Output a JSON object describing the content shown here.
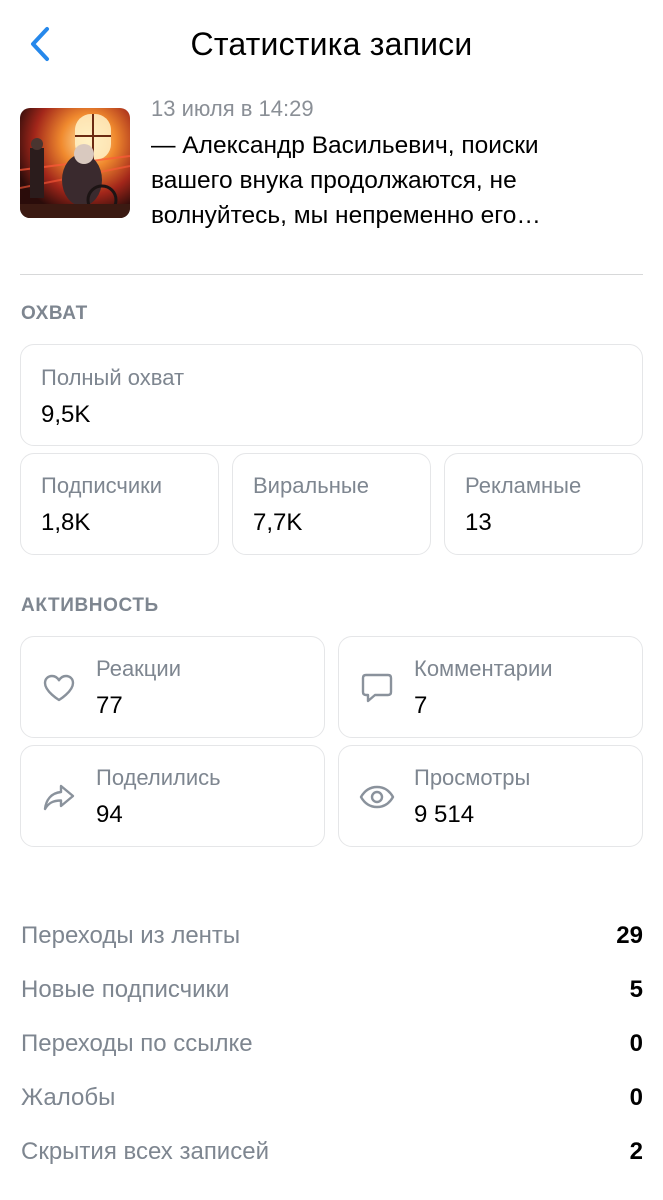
{
  "header": {
    "title": "Статистика записи"
  },
  "post": {
    "date": "13 июля в 14:29",
    "text": "— Александр Васильевич, поиски вашего внука продолжаются, не волнуйтесь, мы непременно его…"
  },
  "reach": {
    "section_title": "ОХВАТ",
    "total": {
      "label": "Полный охват",
      "value": "9,5K"
    },
    "subscribers": {
      "label": "Подписчики",
      "value": "1,8K"
    },
    "viral": {
      "label": "Виральные",
      "value": "7,7K"
    },
    "ads": {
      "label": "Рекламные",
      "value": "13"
    }
  },
  "activity": {
    "section_title": "АКТИВНОСТЬ",
    "reactions": {
      "label": "Реакции",
      "value": "77",
      "icon": "heart-icon"
    },
    "comments": {
      "label": "Комментарии",
      "value": "7",
      "icon": "comment-icon"
    },
    "shares": {
      "label": "Поделились",
      "value": "94",
      "icon": "share-icon"
    },
    "views": {
      "label": "Просмотры",
      "value": "9 514",
      "icon": "eye-icon"
    }
  },
  "stats": [
    {
      "label": "Переходы из ленты",
      "value": "29"
    },
    {
      "label": "Новые подписчики",
      "value": "5"
    },
    {
      "label": "Переходы по ссылке",
      "value": "0"
    },
    {
      "label": "Жалобы",
      "value": "0"
    },
    {
      "label": "Скрытия всех записей",
      "value": "2"
    }
  ],
  "colors": {
    "accent": "#2688eb",
    "secondary_text": "#7e8690",
    "card_border": "#e5e6e8"
  }
}
